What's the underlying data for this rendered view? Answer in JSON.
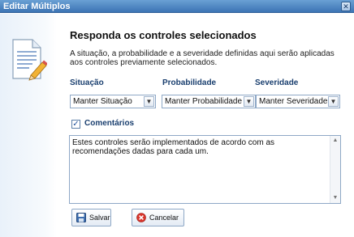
{
  "window": {
    "title": "Editar Múltiplos",
    "close_glyph": "✕"
  },
  "main": {
    "heading": "Responda os controles selecionados",
    "description": "A situação, a probabilidade e a severidade definidas aqui serão aplicadas aos controles previamente selecionados."
  },
  "fields": {
    "situacao": {
      "label": "Situação",
      "value": "Manter Situação"
    },
    "probabilidade": {
      "label": "Probabilidade",
      "value": "Manter Probabilidade"
    },
    "severidade": {
      "label": "Severidade",
      "value": "Manter Severidade"
    }
  },
  "comments": {
    "checkbox_label": "Comentários",
    "checked": true,
    "check_glyph": "✓",
    "text": "Estes controles serão implementados de acordo com as recomendações dadas para cada um."
  },
  "buttons": {
    "save_label": "Salvar",
    "cancel_label": "Cancelar"
  },
  "icons": {
    "document": "document-edit-icon",
    "save": "floppy-disk-icon",
    "cancel": "cancel-circle-icon",
    "dropdown": "chevron-down-icon"
  },
  "colors": {
    "titlebar": "#3c74b4",
    "label_blue": "#1a3f6f",
    "cancel_red": "#d9342b"
  }
}
